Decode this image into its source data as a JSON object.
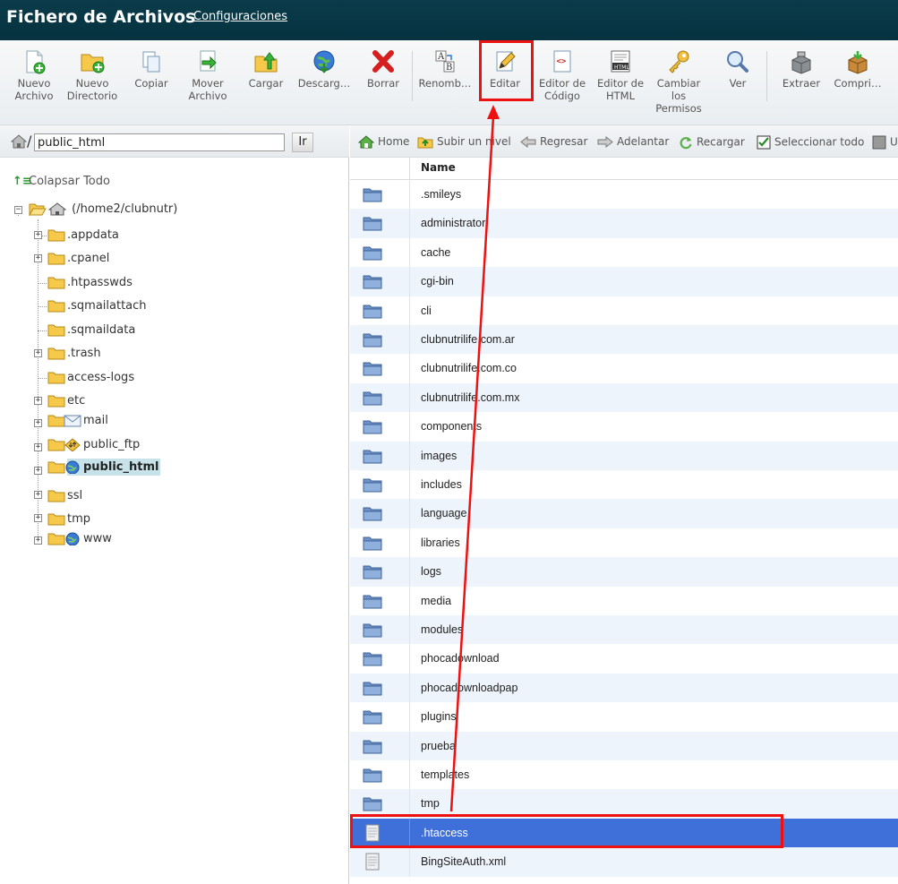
{
  "header": {
    "title": "Fichero de Archivos",
    "settings_link": "Configuraciones"
  },
  "toolbar": {
    "buttons": [
      {
        "id": "new-file",
        "line1": "Nuevo",
        "line2": "Archivo",
        "line3": "",
        "icon": "new-file-icon"
      },
      {
        "id": "new-folder",
        "line1": "Nuevo",
        "line2": "Directorio",
        "line3": "",
        "icon": "new-folder-icon"
      },
      {
        "id": "copy",
        "line1": "Copiar",
        "line2": "",
        "line3": "",
        "icon": "copy-icon"
      },
      {
        "id": "move",
        "line1": "Mover",
        "line2": "Archivo",
        "line3": "",
        "icon": "move-icon"
      },
      {
        "id": "upload",
        "line1": "Cargar",
        "line2": "",
        "line3": "",
        "icon": "upload-icon"
      },
      {
        "id": "download",
        "line1": "Descarg…",
        "line2": "",
        "line3": "",
        "icon": "download-icon"
      },
      {
        "id": "delete",
        "line1": "Borrar",
        "line2": "",
        "line3": "",
        "icon": "delete-icon"
      },
      {
        "id": "rename",
        "line1": "Renomb…",
        "line2": "",
        "line3": "",
        "icon": "rename-icon"
      },
      {
        "id": "edit",
        "line1": "Editar",
        "line2": "",
        "line3": "",
        "icon": "edit-icon"
      },
      {
        "id": "code-editor",
        "line1": "Editor de",
        "line2": "Código",
        "line3": "",
        "icon": "code-editor-icon"
      },
      {
        "id": "html-editor",
        "line1": "Editor de",
        "line2": "HTML",
        "line3": "",
        "icon": "html-editor-icon"
      },
      {
        "id": "permissions",
        "line1": "Cambiar",
        "line2": "los",
        "line3": "Permisos",
        "icon": "key-icon"
      },
      {
        "id": "view",
        "line1": "Ver",
        "line2": "",
        "line3": "",
        "icon": "magnifier-icon"
      },
      {
        "id": "extract",
        "line1": "Extraer",
        "line2": "",
        "line3": "",
        "icon": "extract-icon"
      },
      {
        "id": "compress",
        "line1": "Compri…",
        "line2": "",
        "line3": "",
        "icon": "compress-icon"
      }
    ]
  },
  "path_bar": {
    "slash": "/",
    "path_value": "public_html",
    "go_label": "Ir"
  },
  "tree": {
    "collapse_all": "Colapsar Todo",
    "root": "(/home2/clubnutr)",
    "nodes": [
      {
        "label": ".appdata"
      },
      {
        "label": ".cpanel"
      },
      {
        "label": ".htpasswds"
      },
      {
        "label": ".sqmailattach"
      },
      {
        "label": ".sqmaildata"
      },
      {
        "label": ".trash"
      },
      {
        "label": "access-logs"
      },
      {
        "label": "etc"
      },
      {
        "label": "mail"
      },
      {
        "label": "public_ftp"
      },
      {
        "label": "public_html"
      },
      {
        "label": "ssl"
      },
      {
        "label": "tmp"
      },
      {
        "label": "www"
      }
    ]
  },
  "nav": {
    "home": "Home",
    "up": "Subir un nivel",
    "back": "Regresar",
    "forward": "Adelantar",
    "reload": "Recargar",
    "select_all": "Seleccionar todo",
    "unselect": "U"
  },
  "table": {
    "header_name": "Name",
    "rows": [
      {
        "name": ".smileys",
        "type": "folder"
      },
      {
        "name": "administrator",
        "type": "folder"
      },
      {
        "name": "cache",
        "type": "folder"
      },
      {
        "name": "cgi-bin",
        "type": "folder"
      },
      {
        "name": "cli",
        "type": "folder"
      },
      {
        "name": "clubnutrilife.com.ar",
        "type": "folder"
      },
      {
        "name": "clubnutrilife.com.co",
        "type": "folder"
      },
      {
        "name": "clubnutrilife.com.mx",
        "type": "folder"
      },
      {
        "name": "components",
        "type": "folder"
      },
      {
        "name": "images",
        "type": "folder"
      },
      {
        "name": "includes",
        "type": "folder"
      },
      {
        "name": "language",
        "type": "folder"
      },
      {
        "name": "libraries",
        "type": "folder"
      },
      {
        "name": "logs",
        "type": "folder"
      },
      {
        "name": "media",
        "type": "folder"
      },
      {
        "name": "modules",
        "type": "folder"
      },
      {
        "name": "phocadownload",
        "type": "folder"
      },
      {
        "name": "phocadownloadpap",
        "type": "folder"
      },
      {
        "name": "plugins",
        "type": "folder"
      },
      {
        "name": "prueba",
        "type": "folder"
      },
      {
        "name": "templates",
        "type": "folder"
      },
      {
        "name": "tmp",
        "type": "folder"
      },
      {
        "name": ".htaccess",
        "type": "file",
        "selected": true
      },
      {
        "name": "BingSiteAuth.xml",
        "type": "file"
      }
    ]
  },
  "colors": {
    "header_bg": "#073642",
    "selected_row": "#3f6fd8",
    "annotation_red": "#e11111"
  }
}
